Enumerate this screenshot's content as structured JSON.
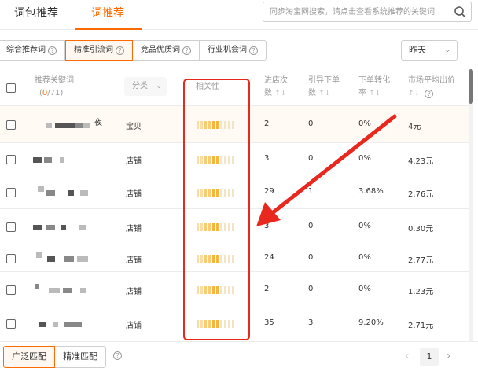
{
  "top_tabs": [
    {
      "label": "词包推荐"
    },
    {
      "label": "词推荐"
    }
  ],
  "search": {
    "placeholder": "同步淘宝网搜索，请点击查看系统推荐的关键词"
  },
  "sub_tabs": [
    {
      "label": "综合推荐词"
    },
    {
      "label": "精准引流词"
    },
    {
      "label": "竞品优质词"
    },
    {
      "label": "行业机会词"
    }
  ],
  "date_filter": {
    "value": "昨天"
  },
  "table": {
    "headers": {
      "keyword": "推荐关键词",
      "keyword_count_selected": "0",
      "keyword_count_total": "/71",
      "category": "分类",
      "relevance": "相关性",
      "visits_line1": "进店次",
      "visits_line2": "数",
      "orders_line1": "引导下单",
      "orders_line2": "数",
      "conversion_line1": "下单转化",
      "conversion_line2": "率",
      "price_line1": "市场平均出价"
    },
    "rows": [
      {
        "category": "宝贝",
        "relevance": 6,
        "visits": "2",
        "orders": "0",
        "conversion": "0%",
        "price": "4元",
        "kw_tail": "夜"
      },
      {
        "category": "店铺",
        "relevance": 6,
        "visits": "3",
        "orders": "0",
        "conversion": "0%",
        "price": "4.23元",
        "kw_tail": ""
      },
      {
        "category": "店铺",
        "relevance": 6,
        "visits": "29",
        "orders": "1",
        "conversion": "3.68%",
        "price": "2.76元",
        "kw_tail": ""
      },
      {
        "category": "店铺",
        "relevance": 6,
        "visits": "3",
        "orders": "0",
        "conversion": "0%",
        "price": "0.30元",
        "kw_tail": ""
      },
      {
        "category": "店铺",
        "relevance": 6,
        "visits": "24",
        "orders": "0",
        "conversion": "0%",
        "price": "2.77元",
        "kw_tail": ""
      },
      {
        "category": "店铺",
        "relevance": 6,
        "visits": "2",
        "orders": "0",
        "conversion": "0%",
        "price": "1.23元",
        "kw_tail": ""
      },
      {
        "category": "店铺",
        "relevance": 6,
        "visits": "35",
        "orders": "3",
        "conversion": "9.20%",
        "price": "2.71元",
        "kw_tail": ""
      }
    ]
  },
  "match_buttons": [
    {
      "label": "广泛匹配"
    },
    {
      "label": "精准匹配"
    }
  ],
  "pagination": {
    "current": "1"
  },
  "colors": {
    "accent": "#ff6a00",
    "annotation": "#e8281f"
  },
  "icons": {
    "search": "search-icon",
    "help": "question-mark-icon",
    "chevron": "chevron-down-icon",
    "sort": "sort-icon"
  }
}
